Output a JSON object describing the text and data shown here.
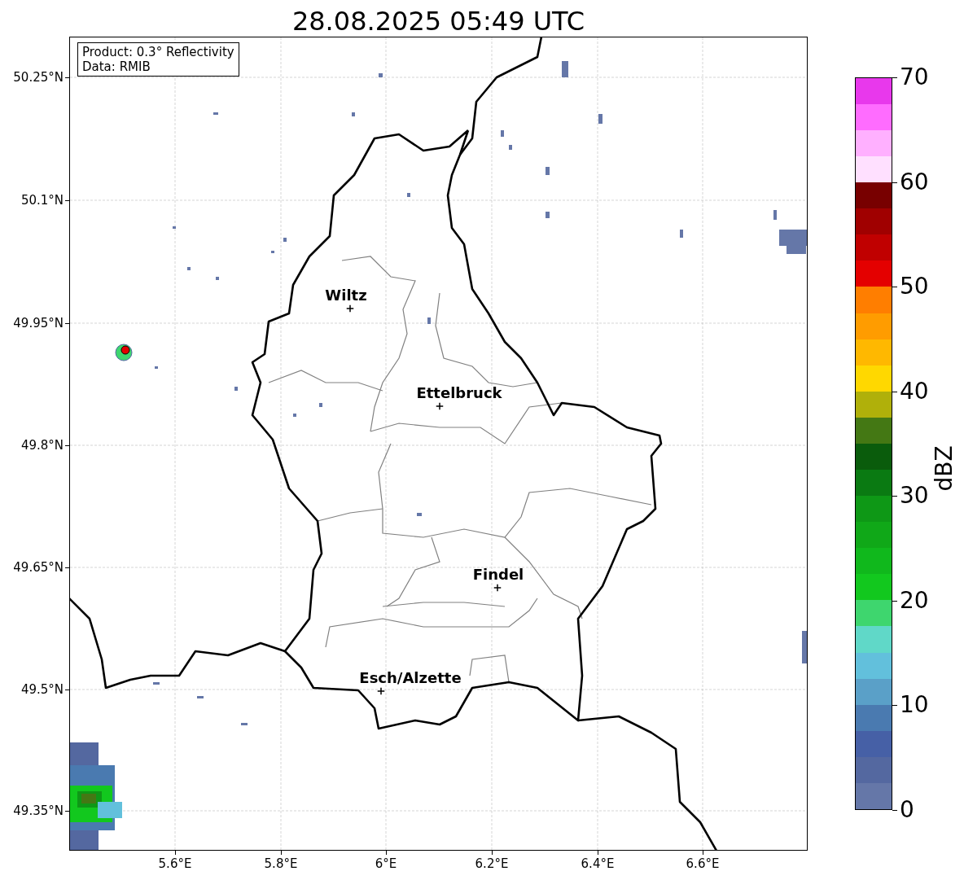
{
  "title": "28.08.2025 05:49 UTC",
  "info_box": {
    "lines": [
      "Product: 0.3° Reflectivity",
      "Data: RMIB"
    ]
  },
  "map": {
    "cities": [
      {
        "name": "Wiltz"
      },
      {
        "name": "Ettelbruck"
      },
      {
        "name": "Findel"
      },
      {
        "name": "Esch/Alzette"
      }
    ]
  },
  "y_ticks": [
    "50.25°N",
    "50.1°N",
    "49.95°N",
    "49.8°N",
    "49.65°N",
    "49.5°N",
    "49.35°N"
  ],
  "x_ticks": [
    "5.6°E",
    "5.8°E",
    "6°E",
    "6.2°E",
    "6.4°E",
    "6.6°E"
  ],
  "colorbar": {
    "label": "dBZ",
    "ticks": [
      "70",
      "60",
      "50",
      "40",
      "30",
      "20",
      "10",
      "0"
    ],
    "bins": [
      {
        "color": "#6577a8"
      },
      {
        "color": "#5468a0"
      },
      {
        "color": "#4660a6"
      },
      {
        "color": "#4a7ab0"
      },
      {
        "color": "#5aa0c8"
      },
      {
        "color": "#62c0dc"
      },
      {
        "color": "#60d8c8"
      },
      {
        "color": "#3ed66e"
      },
      {
        "color": "#12c81e"
      },
      {
        "color": "#10b81c"
      },
      {
        "color": "#10a818"
      },
      {
        "color": "#0e9816"
      },
      {
        "color": "#0a7a12"
      },
      {
        "color": "#0a5c0c"
      },
      {
        "color": "#447814"
      },
      {
        "color": "#b0b00a"
      },
      {
        "color": "#ffd800"
      },
      {
        "color": "#ffb800"
      },
      {
        "color": "#ff9c00"
      },
      {
        "color": "#ff7e00"
      },
      {
        "color": "#e40000"
      },
      {
        "color": "#c00000"
      },
      {
        "color": "#a00000"
      },
      {
        "color": "#780000"
      },
      {
        "color": "#ffe0ff"
      },
      {
        "color": "#ffb0ff"
      },
      {
        "color": "#ff6cff"
      },
      {
        "color": "#e838ec"
      }
    ]
  }
}
